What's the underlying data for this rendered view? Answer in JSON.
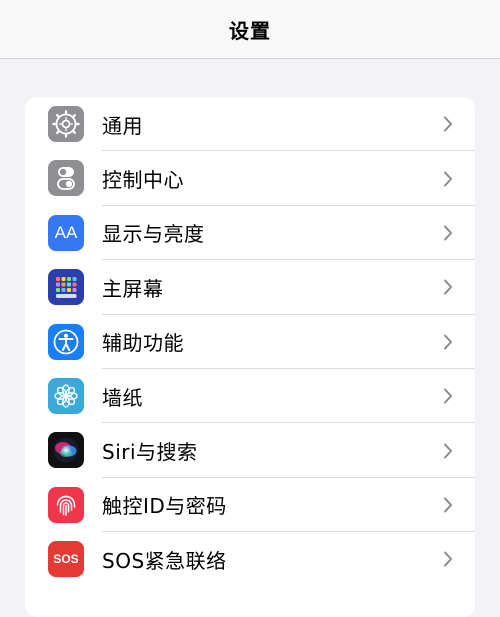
{
  "nav": {
    "title": "设置"
  },
  "settings": {
    "items": [
      {
        "label": "通用",
        "icon": "gear-icon",
        "color": "#8e8e93"
      },
      {
        "label": "控制中心",
        "icon": "toggles-icon",
        "color": "#8e8e93"
      },
      {
        "label": "显示与亮度",
        "icon": "text-size-icon",
        "color": "#3478f6",
        "glyph": "AA"
      },
      {
        "label": "主屏幕",
        "icon": "home-screen-grid-icon",
        "color": "#2c3ea8"
      },
      {
        "label": "辅助功能",
        "icon": "accessibility-icon",
        "color": "#1a7ff5"
      },
      {
        "label": "墙纸",
        "icon": "flower-icon",
        "color": "#3aa9d9"
      },
      {
        "label": "Siri与搜索",
        "icon": "siri-icon",
        "color": "#111111"
      },
      {
        "label": "触控ID与密码",
        "icon": "fingerprint-icon",
        "color": "#f0364b"
      },
      {
        "label": "SOS紧急联络",
        "icon": "sos-icon",
        "color": "#e53935",
        "glyph": "SOS"
      }
    ]
  }
}
